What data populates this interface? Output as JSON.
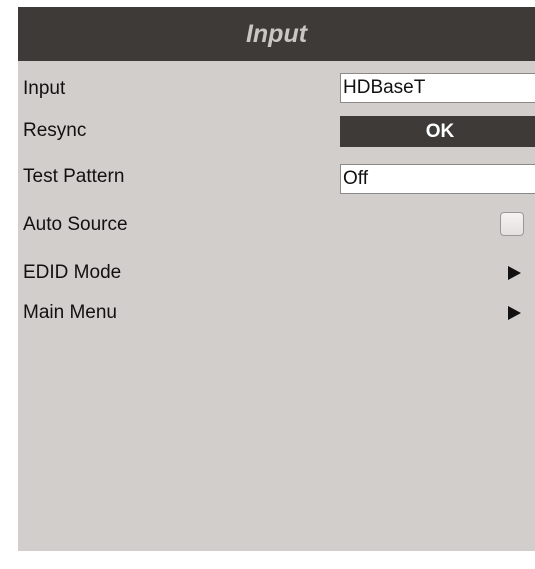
{
  "title": "Input",
  "rows": {
    "input": {
      "label": "Input",
      "value": "HDBaseT"
    },
    "resync": {
      "label": "Resync",
      "button": "OK"
    },
    "test_pattern": {
      "label": "Test Pattern",
      "value": "Off"
    },
    "auto_source": {
      "label": "Auto Source",
      "checked": false
    },
    "edid_mode": {
      "label": "EDID Mode",
      "icon": "right-arrow-icon"
    },
    "main_menu": {
      "label": "Main Menu",
      "icon": "right-arrow-icon"
    }
  },
  "colors": {
    "panel_background": "#d1cecb",
    "title_bar": "#3d3a38",
    "title_text": "#c9c6c3",
    "button": "#3d3a38"
  }
}
